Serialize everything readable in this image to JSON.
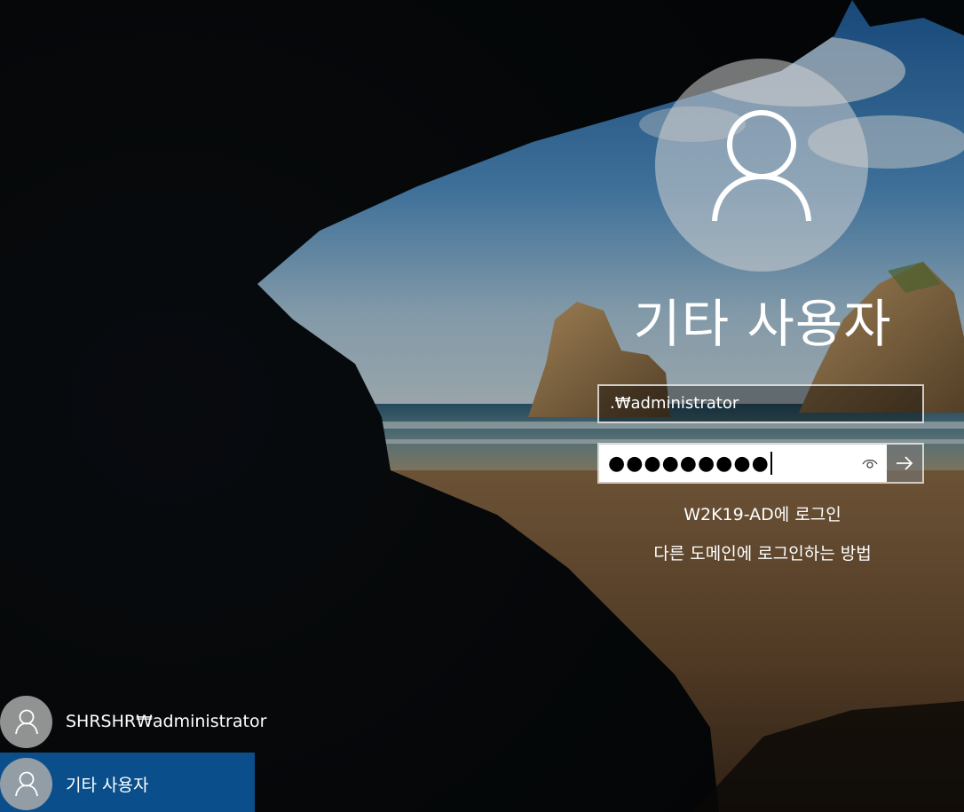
{
  "background": {
    "theme": "windows-10-lock-screen-cave-beach"
  },
  "login": {
    "avatar_icon": "user-silhouette-icon",
    "user_name": "기타 사용자",
    "username_value": ".₩administrator",
    "password_masked": "●●●●●●●●●",
    "reveal_icon": "eye-icon",
    "submit_icon": "arrow-right-icon",
    "sign_in_to": "W2K19-AD에 로그인",
    "other_domain_link": "다른 도메인에 로그인하는 방법"
  },
  "user_list": {
    "items": [
      {
        "label": "SHRSHR₩administrator",
        "icon": "user-silhouette-icon",
        "selected": false
      },
      {
        "label": "기타 사용자",
        "icon": "user-silhouette-icon",
        "selected": true
      }
    ]
  },
  "colors": {
    "selected_user_bg": "#0a4f8b",
    "avatar_bg": "#c8c8c8",
    "text": "#ffffff"
  }
}
